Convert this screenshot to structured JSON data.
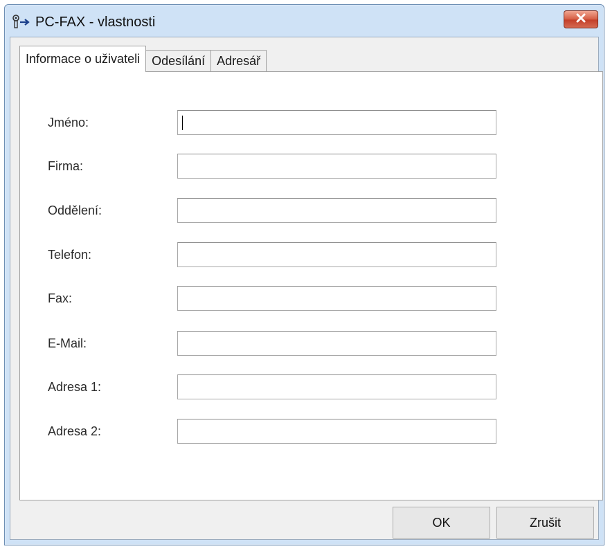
{
  "window": {
    "title": "PC-FAX - vlastnosti",
    "icons": {
      "app": "pc-fax-icon",
      "close": "close-icon"
    }
  },
  "tabs": [
    {
      "label": "Informace o uživateli",
      "active": true
    },
    {
      "label": "Odesílání",
      "active": false
    },
    {
      "label": "Adresář",
      "active": false
    }
  ],
  "form": {
    "fields": [
      {
        "label": "Jméno:",
        "value": ""
      },
      {
        "label": "Firma:",
        "value": ""
      },
      {
        "label": "Oddělení:",
        "value": ""
      },
      {
        "label": "Telefon:",
        "value": ""
      },
      {
        "label": "Fax:",
        "value": ""
      },
      {
        "label": "E-Mail:",
        "value": ""
      },
      {
        "label": "Adresa 1:",
        "value": ""
      },
      {
        "label": "Adresa 2:",
        "value": ""
      }
    ]
  },
  "buttons": {
    "ok": "OK",
    "cancel": "Zrušit"
  },
  "colors": {
    "titlebar": "#cfe2f6",
    "close": "#c4402a",
    "client": "#f0f0f0"
  }
}
